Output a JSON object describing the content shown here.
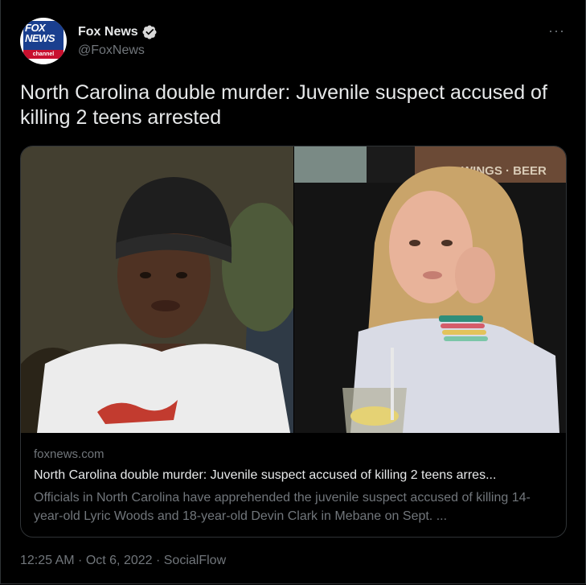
{
  "account": {
    "name": "Fox News",
    "handle": "@FoxNews",
    "avatar_lines": [
      "FOX",
      "NEWS",
      "channel"
    ],
    "verified_icon": "verified-badge-icon"
  },
  "more_label": "···",
  "tweet_text": "North Carolina double murder: Juvenile suspect accused of killing 2 teens arrested",
  "card": {
    "domain": "foxnews.com",
    "title": "North Carolina double murder: Juvenile suspect accused of killing 2 teens arres...",
    "description": "Officials in North Carolina have apprehended the juvenile suspect accused of killing 14-year-old Lyric Woods and 18-year-old Devin Clark in Mebane on Sept. ...",
    "background_sign": "WINGS · BEER"
  },
  "meta": "12:25 AM · Oct 6, 2022 · SocialFlow",
  "colors": {
    "background": "#000000",
    "text": "#e7e9ea",
    "muted": "#71767b",
    "border": "#2f3336",
    "verified": "#d9d9d9"
  }
}
